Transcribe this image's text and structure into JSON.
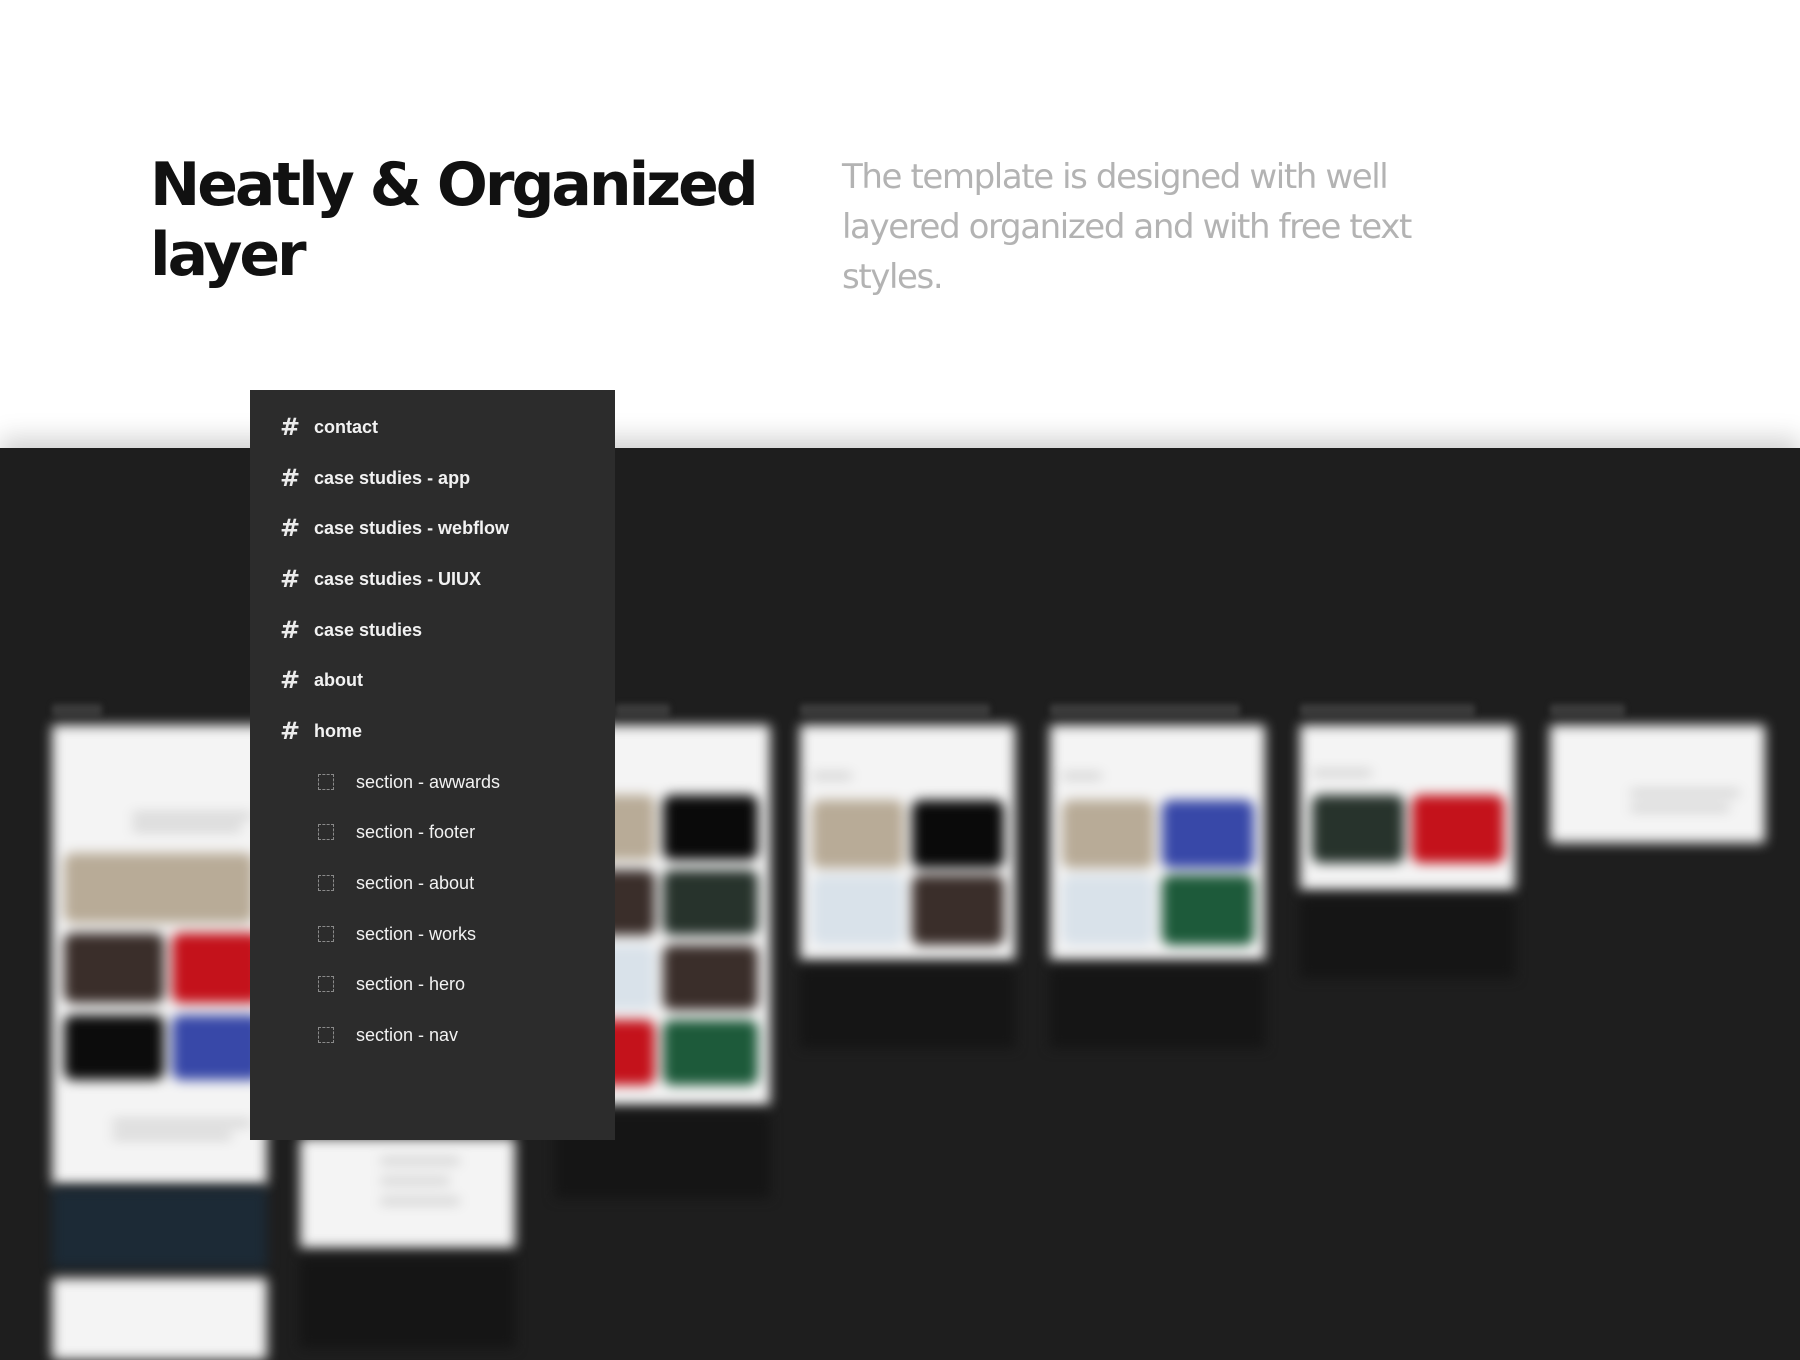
{
  "header": {
    "title_line1": "Neatly & Organized",
    "title_line2": "layer",
    "description": "The template is designed with well layered organized and with free text styles."
  },
  "colors": {
    "canvas_bg": "#1e1e1e",
    "panel_bg": "#2c2c2c",
    "text_dark": "#111111",
    "text_muted": "#b3b3b3",
    "accent_red": "#c4121b",
    "accent_green": "#1d5a3a"
  },
  "layers_panel": {
    "frames": [
      {
        "label": "contact",
        "icon": "hash-icon"
      },
      {
        "label": "case studies - app",
        "icon": "hash-icon"
      },
      {
        "label": "case studies - webflow",
        "icon": "hash-icon"
      },
      {
        "label": "case studies - UIUX",
        "icon": "hash-icon"
      },
      {
        "label": "case studies",
        "icon": "hash-icon"
      },
      {
        "label": "about",
        "icon": "hash-icon"
      },
      {
        "label": "home",
        "icon": "hash-icon"
      }
    ],
    "sections": [
      {
        "label": "section - awwards",
        "icon": "section-icon"
      },
      {
        "label": "section - footer",
        "icon": "section-icon"
      },
      {
        "label": "section - about",
        "icon": "section-icon"
      },
      {
        "label": "section - works",
        "icon": "section-icon"
      },
      {
        "label": "section - hero",
        "icon": "section-icon"
      },
      {
        "label": "section - nav",
        "icon": "section-icon"
      }
    ]
  }
}
